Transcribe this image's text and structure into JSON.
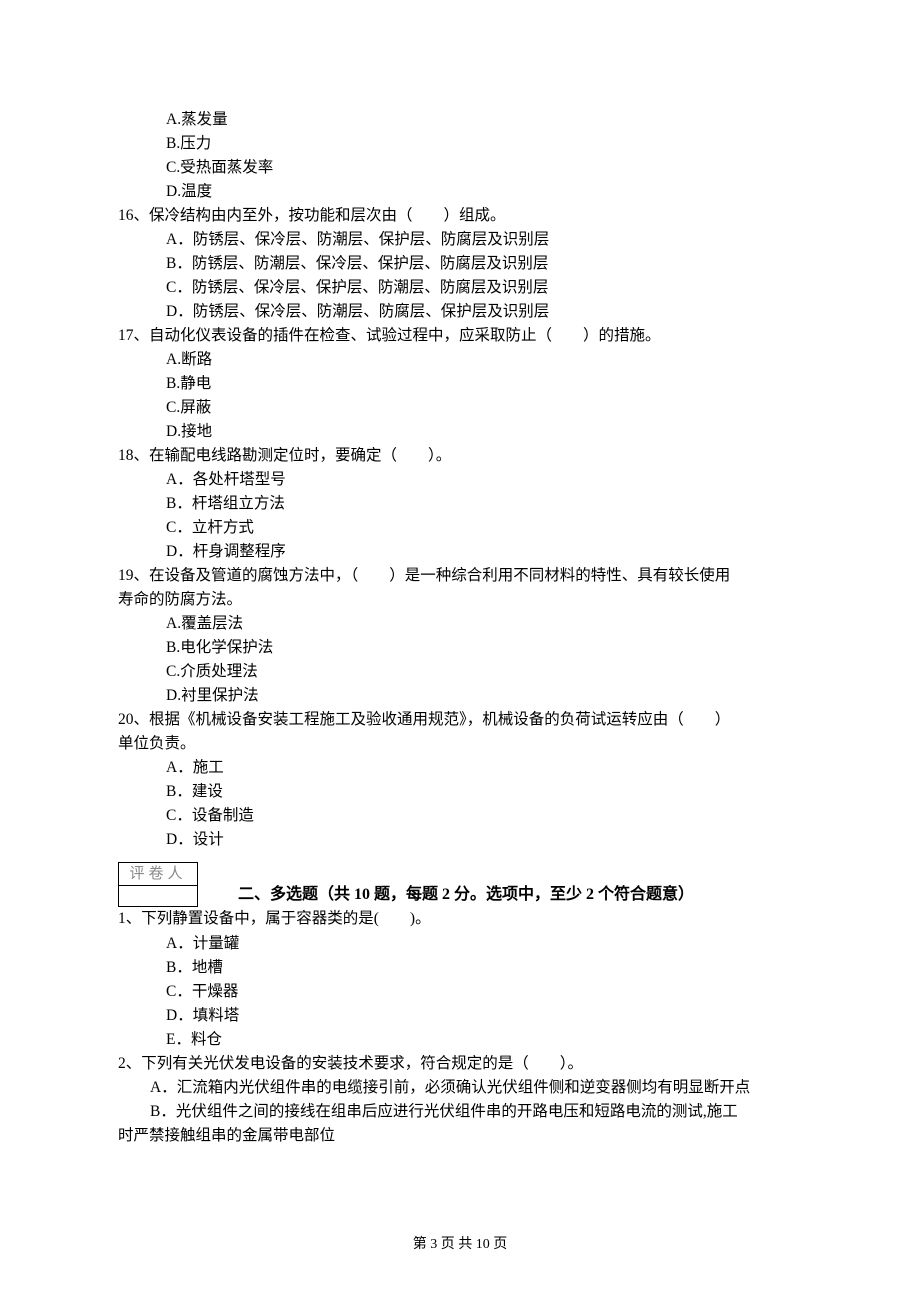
{
  "q15_options": {
    "A": "A.蒸发量",
    "B": "B.压力",
    "C": "C.受热面蒸发率",
    "D": "D.温度"
  },
  "q16": {
    "text": "16、保冷结构由内至外，按功能和层次由（　　）组成。",
    "A": "A．防锈层、保冷层、防潮层、保护层、防腐层及识别层",
    "B": "B．防锈层、防潮层、保冷层、保护层、防腐层及识别层",
    "C": "C．防锈层、保冷层、保护层、防潮层、防腐层及识别层",
    "D": "D．防锈层、保冷层、防潮层、防腐层、保护层及识别层"
  },
  "q17": {
    "text": "17、自动化仪表设备的插件在检查、试验过程中，应采取防止（　　）的措施。",
    "A": "A.断路",
    "B": "B.静电",
    "C": "C.屏蔽",
    "D": "D.接地"
  },
  "q18": {
    "text": "18、在输配电线路勘测定位时，要确定（　　）。",
    "A": "A．各处杆塔型号",
    "B": "B．杆塔组立方法",
    "C": "C．立杆方式",
    "D": "D．杆身调整程序"
  },
  "q19": {
    "text1": "19、在设备及管道的腐蚀方法中，（　　）是一种综合利用不同材料的特性、具有较长使用",
    "text2": "寿命的防腐方法。",
    "A": "A.覆盖层法",
    "B": "B.电化学保护法",
    "C": "C.介质处理法",
    "D": "D.衬里保护法"
  },
  "q20": {
    "text1": "20、根据《机械设备安装工程施工及验收通用规范》，机械设备的负荷试运转应由（　　）",
    "text2": "单位负责。",
    "A": "A．施工",
    "B": "B．建设",
    "C": "C．设备制造",
    "D": "D．设计"
  },
  "grader_label": "评卷人",
  "section2_title": "二、多选题（共 10 题，每题 2 分。选项中，至少 2 个符合题意）",
  "s2_q1": {
    "text": "1、下列静置设备中，属于容器类的是(　　)。",
    "A": "A．计量罐",
    "B": "B．地槽",
    "C": "C．干燥器",
    "D": "D．填料塔",
    "E": "E．料仓"
  },
  "s2_q2": {
    "text": "2、下列有关光伏发电设备的安装技术要求，符合规定的是（　　）。",
    "A": "A．汇流箱内光伏组件串的电缆接引前，必须确认光伏组件侧和逆变器侧均有明显断开点",
    "B1": "B．光伏组件之间的接线在组串后应进行光伏组件串的开路电压和短路电流的测试,施工",
    "B2": "时严禁接触组串的金属带电部位"
  },
  "footer": "第 3 页 共 10 页"
}
